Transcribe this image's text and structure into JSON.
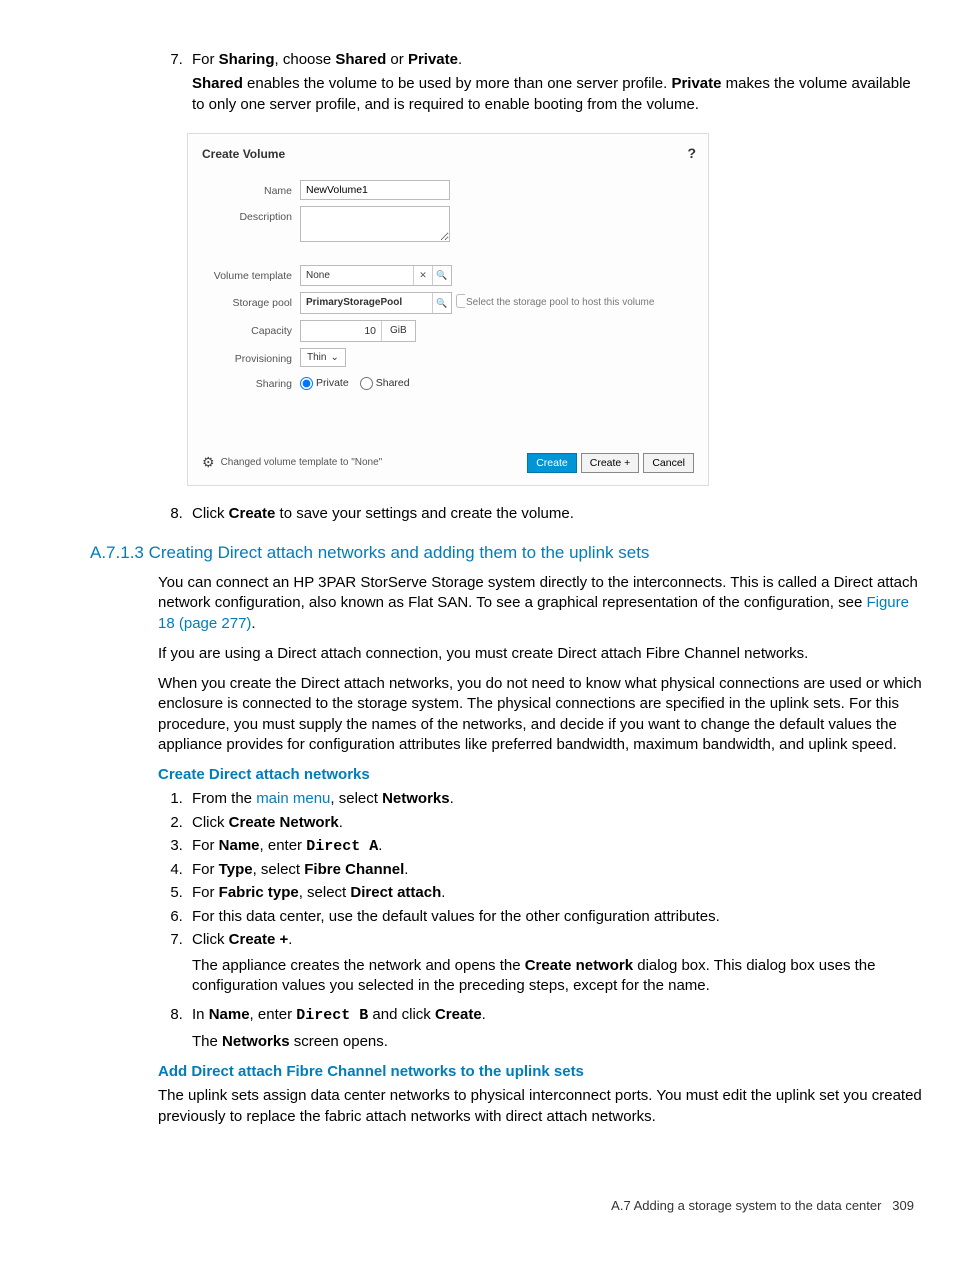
{
  "step7": {
    "num": "7.",
    "line1_pre": "For ",
    "line1_b1": "Sharing",
    "line1_mid": ", choose ",
    "line1_b2": "Shared",
    "line1_or": " or ",
    "line1_b3": "Private",
    "line1_end": ".",
    "line2_b1": "Shared",
    "line2_mid": " enables the volume to be used by more than one server profile. ",
    "line2_b2": "Private",
    "line2_end": " makes the volume available to only one server profile, and is required to enable booting from the volume."
  },
  "dialog": {
    "title": "Create Volume",
    "help": "?",
    "labels": {
      "name": "Name",
      "description": "Description",
      "volume_template": "Volume template",
      "storage_pool": "Storage pool",
      "capacity": "Capacity",
      "provisioning": "Provisioning",
      "sharing": "Sharing"
    },
    "values": {
      "name": "NewVolume1",
      "volume_template": "None",
      "storage_pool": "PrimaryStoragePool",
      "capacity": "10",
      "capacity_unit": "GiB",
      "provisioning": "Thin",
      "sharing_private": "Private",
      "sharing_shared": "Shared"
    },
    "hint_storage_pool": "Select the storage pool to host this volume",
    "icons": {
      "clear": "✕",
      "search": "🔍",
      "caret": "⌄"
    },
    "status": "Changed volume template to \"None\"",
    "buttons": {
      "create": "Create",
      "create_plus": "Create +",
      "cancel": "Cancel"
    }
  },
  "step8": {
    "pre": "Click ",
    "b": "Create",
    "post": " to save your settings and create the volume."
  },
  "section": {
    "heading": "A.7.1.3 Creating Direct attach networks and adding them to the uplink sets",
    "p1_a": "You can connect an HP 3PAR StorServe Storage system directly to the interconnects. This is called a Direct attach network configuration, also known as Flat SAN. To see a graphical representation of the configuration, see ",
    "p1_link": "Figure 18 (page 277)",
    "p1_b": ".",
    "p2": "If you are using a Direct attach connection, you must create Direct attach Fibre Channel networks.",
    "p3": "When you create the Direct attach networks, you do not need to know what physical connections are used or which enclosure is connected to the storage system. The physical connections are specified in the uplink sets. For this procedure, you must supply the names of the networks, and decide if you want to change the default values the appliance provides for configuration attributes like preferred bandwidth, maximum bandwidth, and uplink speed.",
    "sub1": "Create Direct attach networks",
    "ol1": {
      "i1_a": "From the ",
      "i1_link": "main menu",
      "i1_b": ", select ",
      "i1_bold": "Networks",
      "i1_c": ".",
      "i2_a": "Click ",
      "i2_bold": "Create Network",
      "i2_b": ".",
      "i3_a": "For ",
      "i3_b1": "Name",
      "i3_mid": ", enter ",
      "i3_code": "Direct A",
      "i3_end": ".",
      "i4_a": "For ",
      "i4_b1": "Type",
      "i4_mid": ", select ",
      "i4_b2": "Fibre Channel",
      "i4_end": ".",
      "i5_a": "For ",
      "i5_b1": "Fabric type",
      "i5_mid": ", select ",
      "i5_b2": "Direct attach",
      "i5_end": ".",
      "i6": "For this data center, use the default values for the other configuration attributes.",
      "i7_a": "Click ",
      "i7_b": "Create +",
      "i7_c": ".",
      "i7_p_a": "The appliance creates the network and opens the ",
      "i7_p_b": "Create network",
      "i7_p_c": " dialog box. This dialog box uses the configuration values you selected in the preceding steps, except for the name.",
      "i8_a": "In ",
      "i8_b1": "Name",
      "i8_mid": ", enter ",
      "i8_code": "Direct B",
      "i8_mid2": " and click ",
      "i8_b2": "Create",
      "i8_end": ".",
      "i8_p_a": "The ",
      "i8_p_b": "Networks",
      "i8_p_c": " screen opens."
    },
    "sub2": "Add Direct attach Fibre Channel networks to the uplink sets",
    "p4": "The uplink sets assign data center networks to physical interconnect ports. You must edit the uplink set you created previously to replace the fabric attach networks with direct attach networks."
  },
  "footer": {
    "text": "A.7 Adding a storage system to the data center",
    "page": "309"
  }
}
